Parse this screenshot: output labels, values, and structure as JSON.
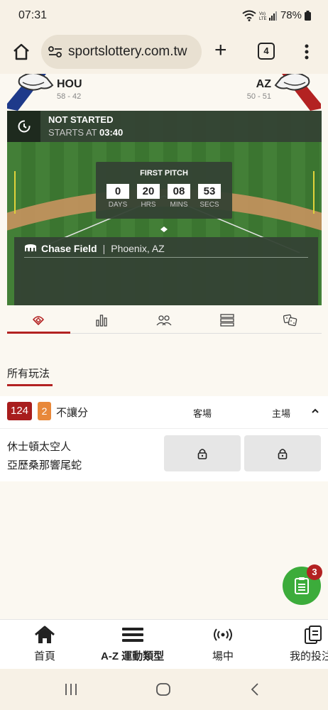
{
  "status_bar": {
    "time": "07:31",
    "battery": "78%"
  },
  "browser": {
    "url": "sportslottery.com.tw",
    "tab_count": "4"
  },
  "match": {
    "away_team": {
      "abbr": "HOU",
      "record": "58 - 42"
    },
    "home_team": {
      "abbr": "AZ",
      "record": "50 - 51"
    },
    "status": "NOT STARTED",
    "starts_at_label": "STARTS AT",
    "starts_at_time": "03:40",
    "countdown_title": "FIRST PITCH",
    "countdown": [
      {
        "value": "0",
        "label": "DAYS"
      },
      {
        "value": "20",
        "label": "HRS"
      },
      {
        "value": "08",
        "label": "MINS"
      },
      {
        "value": "53",
        "label": "SECS"
      }
    ],
    "venue_name": "Chase Field",
    "venue_separator": "|",
    "venue_city": "Phoenix, AZ"
  },
  "tabs": [
    {
      "icon": "baseball-field-icon",
      "active": true
    },
    {
      "icon": "bar-chart-icon",
      "active": false
    },
    {
      "icon": "lineup-icon",
      "active": false
    },
    {
      "icon": "list-icon",
      "active": false
    },
    {
      "icon": "dice-icon",
      "active": false
    }
  ],
  "markets": {
    "section_title": "所有玩法",
    "header": {
      "count": "124",
      "live_count": "2",
      "name": "不讓分",
      "away_col": "客場",
      "home_col": "主場"
    },
    "row": {
      "team1": "休士頓太空人",
      "team2": "亞歷桑那響尾蛇"
    }
  },
  "bet_slip": {
    "count": "3"
  },
  "bottom_nav": [
    {
      "label": "首頁",
      "icon": "home-icon"
    },
    {
      "label": "A-Z 運動類型",
      "icon": "menu-icon"
    },
    {
      "label": "場中",
      "icon": "live-icon"
    },
    {
      "label": "我的投注",
      "icon": "my-bets-icon"
    }
  ],
  "colors": {
    "accent": "#b32222",
    "field_green": "#3f7d34",
    "fab_green": "#3cac3b",
    "live_orange": "#e8883a"
  }
}
